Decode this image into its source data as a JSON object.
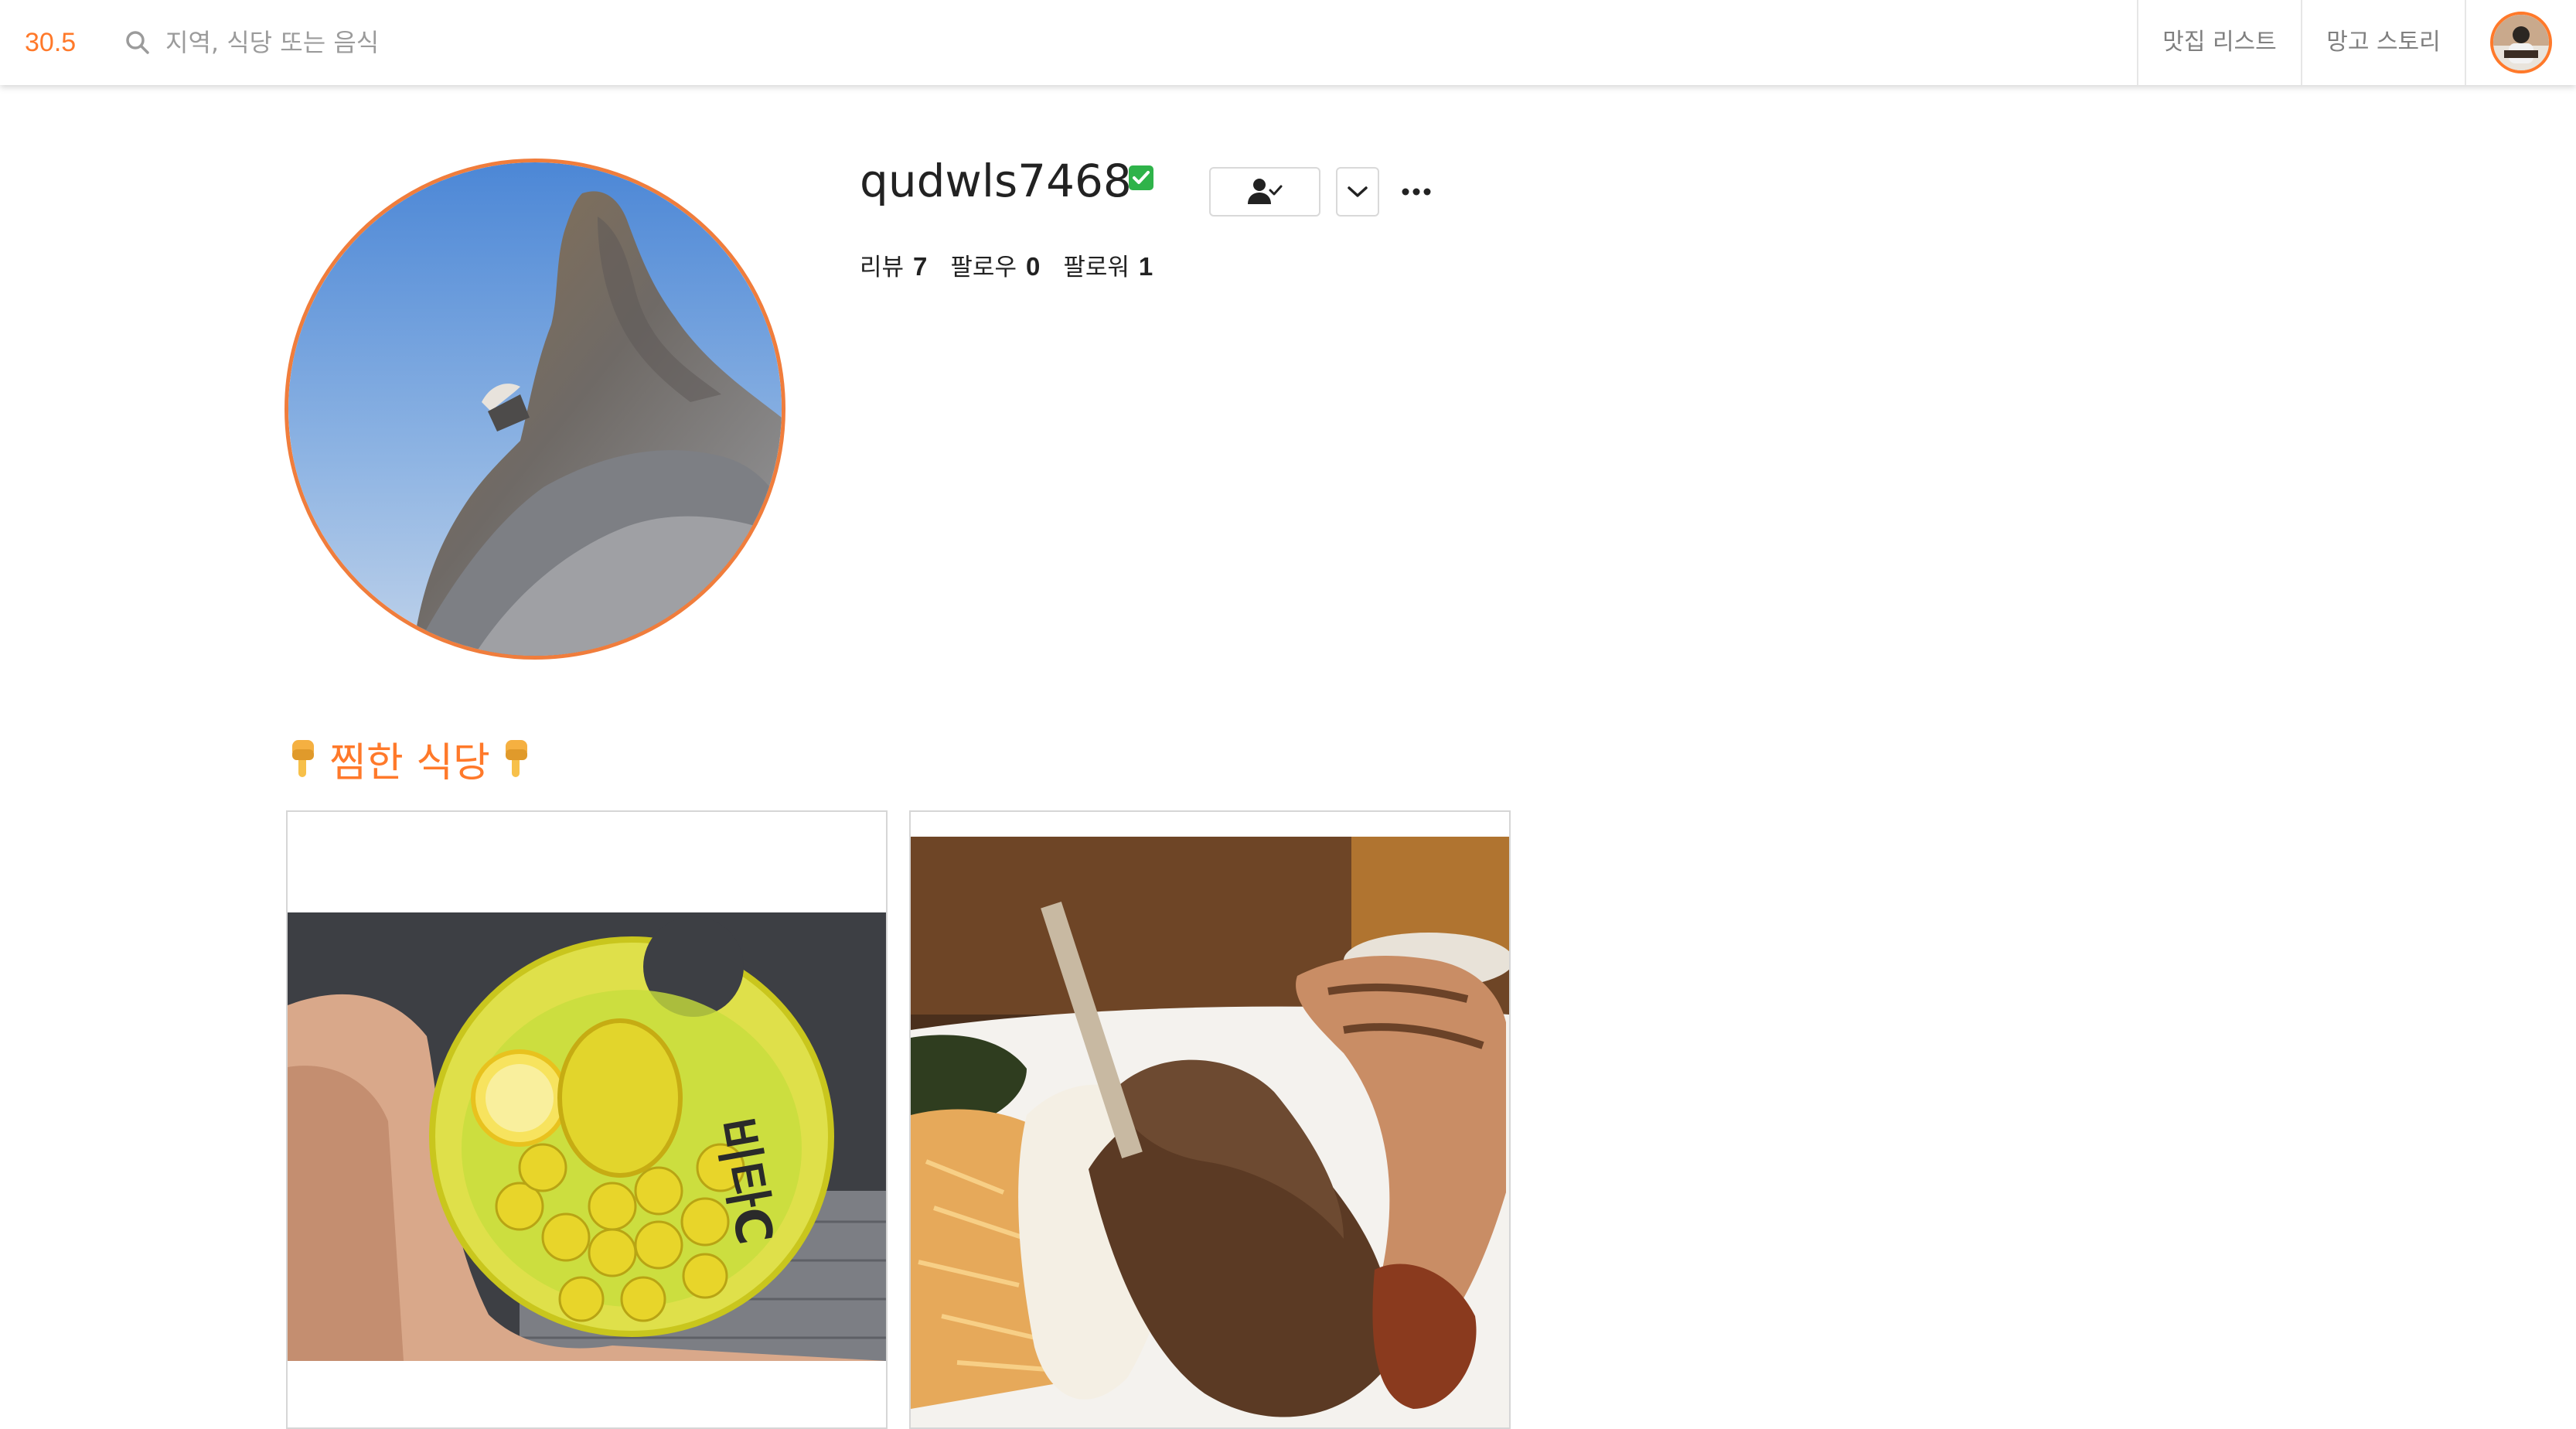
{
  "header": {
    "brand": "30.5",
    "search_placeholder": "지역, 식당 또는 음식",
    "nav": {
      "list_label": "맛집 리스트",
      "story_label": "망고 스토리"
    }
  },
  "profile": {
    "username": "qudwls7468",
    "stats": [
      {
        "label": "리뷰",
        "value": "7"
      },
      {
        "label": "팔로우",
        "value": "0"
      },
      {
        "label": "팔로워",
        "value": "1"
      }
    ]
  },
  "wishlist": {
    "title": "찜한 식당",
    "cards": [
      {
        "image": "lemon-candy-photo"
      },
      {
        "image": "grilled-meat-platter-photo"
      }
    ]
  },
  "colors": {
    "accent": "#ff792a",
    "verified": "#2fb34a",
    "border": "#d6d6d6"
  }
}
